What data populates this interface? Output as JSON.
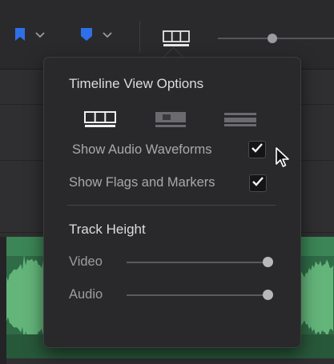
{
  "toolbar": {
    "flag_icon": "flag-icon",
    "marker_icon": "marker-icon",
    "flag_color": "#2f6fe8",
    "timeline_view_icon": "timeline-view-options-icon",
    "zoom_level": 0.45
  },
  "popover": {
    "title": "Timeline View Options",
    "view_modes": [
      "stacked-timeline-icon",
      "timeline-tabs-icon",
      "single-track-icon"
    ],
    "options": [
      {
        "label": "Show Audio Waveforms",
        "checked": true
      },
      {
        "label": "Show Flags and Markers",
        "checked": true
      }
    ],
    "track_height": {
      "title": "Track Height",
      "video_label": "Video",
      "audio_label": "Audio",
      "video_value": 1.0,
      "audio_value": 1.0
    }
  },
  "colors": {
    "audio_clip": "#2f6b46",
    "waveform": "#64b57a"
  }
}
